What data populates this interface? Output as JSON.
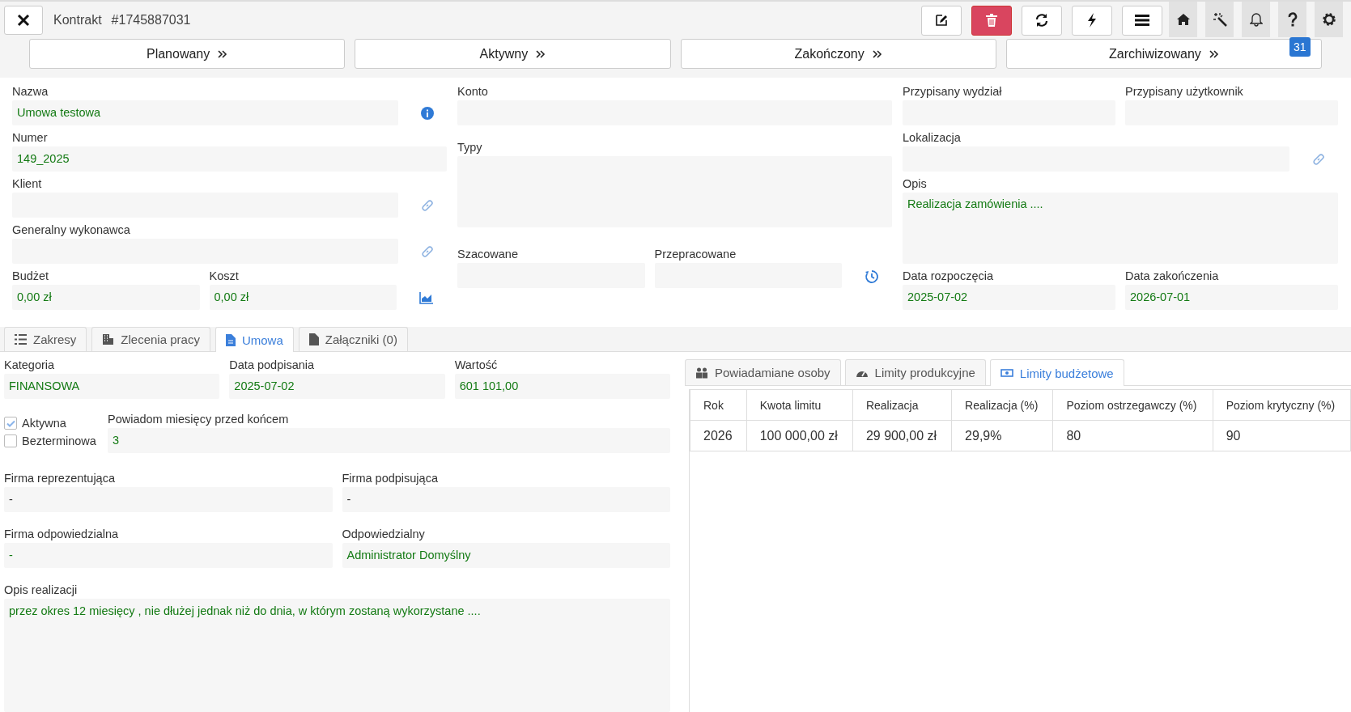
{
  "header": {
    "title": "Kontrakt",
    "number": "#1745887031"
  },
  "toolbar": [
    {
      "kind": "edit"
    },
    {
      "kind": "delete"
    },
    {
      "kind": "refresh"
    },
    {
      "kind": "action"
    },
    {
      "kind": "menu"
    }
  ],
  "nav_icons": [
    {
      "kind": "home"
    },
    {
      "kind": "wand"
    },
    {
      "kind": "bell"
    },
    {
      "kind": "help",
      "badge": "31"
    },
    {
      "kind": "settings"
    }
  ],
  "stages": [
    "Planowany",
    "Aktywny",
    "Zakończony",
    "Zarchiwizowany"
  ],
  "form": {
    "name": {
      "label": "Nazwa",
      "value": "Umowa testowa"
    },
    "number": {
      "label": "Numer",
      "value": "149_2025"
    },
    "client": {
      "label": "Klient"
    },
    "general_contractor": {
      "label": "Generalny wykonawca"
    },
    "budget": {
      "label": "Budżet",
      "value": "0,00 zł"
    },
    "cost": {
      "label": "Koszt",
      "value": "0,00 zł"
    },
    "account": {
      "label": "Konto"
    },
    "types": {
      "label": "Typy"
    },
    "estimated": {
      "label": "Szacowane"
    },
    "worked": {
      "label": "Przepracowane"
    },
    "department": {
      "label": "Przypisany wydział"
    },
    "user": {
      "label": "Przypisany użytkownik"
    },
    "location": {
      "label": "Lokalizacja"
    },
    "description": {
      "label": "Opis",
      "value": "Realizacja zamówienia ...."
    },
    "start_date": {
      "label": "Data rozpoczęcia",
      "value": "2025-07-02"
    },
    "end_date": {
      "label": "Data zakończenia",
      "value": "2026-07-01"
    }
  },
  "tabs": [
    {
      "label": "Zakresy",
      "kind": "list",
      "selected": false
    },
    {
      "label": "Zlecenia pracy",
      "kind": "building",
      "selected": false
    },
    {
      "label": "Umowa",
      "kind": "document",
      "selected": true
    },
    {
      "label": "Załączniki (0)",
      "kind": "file",
      "selected": false
    }
  ],
  "contract": {
    "category": {
      "label": "Kategoria",
      "value": "FINANSOWA"
    },
    "signed_date": {
      "label": "Data podpisania",
      "value": "2025-07-02"
    },
    "amount": {
      "label": "Wartość",
      "value": "601 101,00"
    },
    "checkboxes": [
      {
        "label": "Aktywna",
        "checked": true
      },
      {
        "label": "Bezterminowa",
        "checked": false
      }
    ],
    "notify_months": {
      "label": "Powiadom miesięcy przed końcem",
      "value": "3"
    },
    "representing_company": {
      "label": "Firma reprezentująca",
      "value": "-"
    },
    "signing_company": {
      "label": "Firma podpisująca",
      "value": "-"
    },
    "responsible_company": {
      "label": "Firma odpowiedzialna",
      "value": "-"
    },
    "responsible": {
      "label": "Odpowiedzialny",
      "value": "Administrator Domyślny"
    },
    "realization_description": {
      "label": "Opis realizacji",
      "value": "przez okres 12 miesięcy , nie dłużej jednak niż do dnia, w którym zostaną wykorzystane ...."
    }
  },
  "subtabs": [
    {
      "label": "Powiadamiane osoby",
      "kind": "people",
      "selected": false
    },
    {
      "label": "Limity produkcyjne",
      "kind": "gauge",
      "selected": false
    },
    {
      "label": "Limity budżetowe",
      "kind": "money",
      "selected": true
    }
  ],
  "limits_table": {
    "columns": [
      "Rok",
      "Kwota limitu",
      "Realizacja",
      "Realizacja (%)",
      "Poziom ostrzegawczy (%)",
      "Poziom krytyczny (%)"
    ],
    "rows": [
      [
        "2026",
        "100 000,00 zł",
        "29 900,00 zł",
        "29,9%",
        "80",
        "90"
      ]
    ]
  }
}
